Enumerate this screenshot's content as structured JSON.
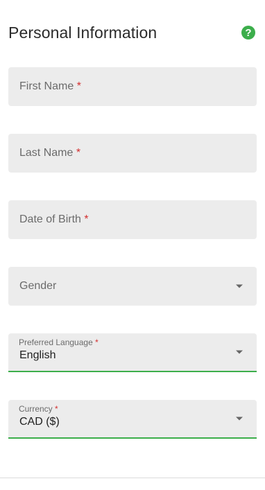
{
  "header": {
    "title": "Personal Information",
    "help_icon": "?"
  },
  "form": {
    "first_name": {
      "label": "First Name",
      "required_mark": "*"
    },
    "last_name": {
      "label": "Last Name",
      "required_mark": "*"
    },
    "date_of_birth": {
      "label": "Date of Birth",
      "required_mark": "*"
    },
    "gender": {
      "label": "Gender"
    },
    "preferred_language": {
      "label": "Preferred Language",
      "required_mark": "*",
      "value": "English"
    },
    "currency": {
      "label": "Currency",
      "required_mark": "*",
      "value": "CAD ($)"
    }
  },
  "colors": {
    "accent": "#3cae4b",
    "required": "#d32f2f",
    "field_bg": "#ececec"
  },
  "icons": {
    "help": "question-circle-icon",
    "dropdown": "caret-down-icon"
  }
}
